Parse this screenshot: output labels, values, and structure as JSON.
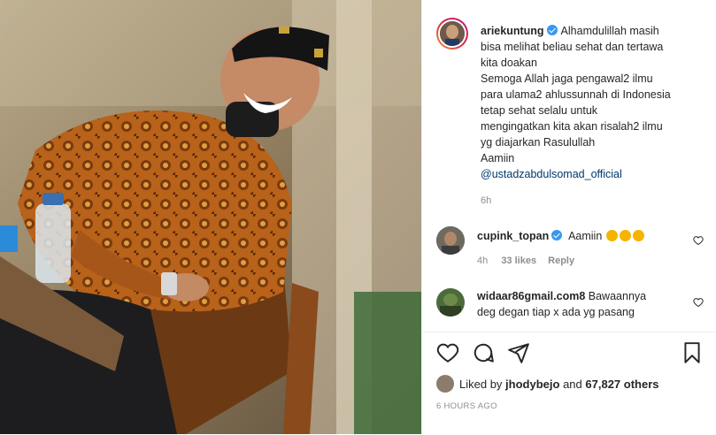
{
  "post": {
    "author": "ariekuntung",
    "caption_lines": [
      "Alhamdulillah masih",
      "bisa melihat beliau sehat dan tertawa",
      "kita doakan",
      "Semoga Allah jaga pengawal2 ilmu",
      "para ulama2 ahlussunnah di Indonesia",
      "tetap sehat selalu untuk",
      "mengingatkan kita akan risalah2 ilmu",
      "yg diajarkan Rasulullah",
      "Aamiin"
    ],
    "mention": "@ustadzabdulsomad_official",
    "caption_time": "6h"
  },
  "comments": [
    {
      "user": "cupink_topan",
      "text": "Aamiin",
      "time": "4h",
      "likes": "33 likes",
      "reply": "Reply"
    },
    {
      "user": "widaar86gmail.com8",
      "text_lines": [
        "Bawaannya",
        "deg degan tiap x ada yg pasang"
      ]
    }
  ],
  "likes": {
    "prefix": "Liked by",
    "user": "jhodybejo",
    "and": "and",
    "count": "67,827 others"
  },
  "time_ago": "6 HOURS AGO",
  "colors": {
    "accent": "#3897f0",
    "mention": "#00376b",
    "meta": "#8e8e8e"
  },
  "icons": [
    "verified-badge-icon",
    "heart-icon",
    "comment-icon",
    "share-icon",
    "bookmark-icon",
    "emoji-icon"
  ]
}
